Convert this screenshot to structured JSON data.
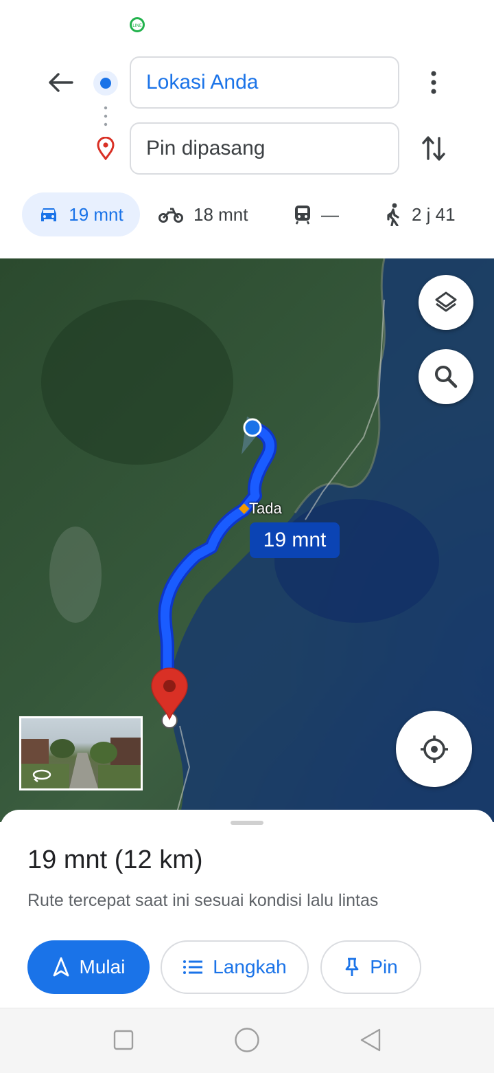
{
  "status_bar": {
    "icon": "line-app-icon"
  },
  "directions": {
    "back_icon": "arrow-left-icon",
    "origin": {
      "value": "Lokasi Anda",
      "icon": "blue-dot-icon"
    },
    "destination": {
      "value": "Pin dipasang",
      "icon": "red-pin-outline-icon"
    },
    "more_icon": "more-vertical-icon",
    "swap_icon": "swap-vertical-icon"
  },
  "travel_modes": [
    {
      "mode": "car",
      "icon": "car-icon",
      "label": "19 mnt",
      "active": true
    },
    {
      "mode": "motorcycle",
      "icon": "motorcycle-icon",
      "label": "18 mnt",
      "active": false
    },
    {
      "mode": "transit",
      "icon": "train-icon",
      "label": "—",
      "active": false
    },
    {
      "mode": "walk",
      "icon": "walk-icon",
      "label": "2 j 41",
      "active": false
    }
  ],
  "map": {
    "place_label": "Tada",
    "route_eta": "19 mnt",
    "layers_icon": "layers-icon",
    "search_icon": "search-icon",
    "locate_icon": "my-location-icon",
    "streetview_icon": "rotate-360-icon",
    "colors": {
      "route": "#1a5cff",
      "route_border": "#0d36c9",
      "eta_bubble": "#0b44b4",
      "pin": "#d93025"
    }
  },
  "summary": {
    "title": "19 mnt (12 km)",
    "subtitle": "Rute tercepat saat ini sesuai kondisi lalu lintas"
  },
  "actions": {
    "start": {
      "label": "Mulai",
      "icon": "navigation-arrow-icon"
    },
    "steps": {
      "label": "Langkah",
      "icon": "list-icon"
    },
    "pin": {
      "label": "Pin",
      "icon": "pushpin-icon"
    }
  },
  "nav_bar": {
    "recent_icon": "square-icon",
    "home_icon": "circle-icon",
    "back_icon": "triangle-back-icon"
  },
  "colors": {
    "accent": "#1a73e8",
    "accent_light": "#e8f0fe",
    "text_primary": "#202124",
    "text_secondary": "#5f6368"
  }
}
